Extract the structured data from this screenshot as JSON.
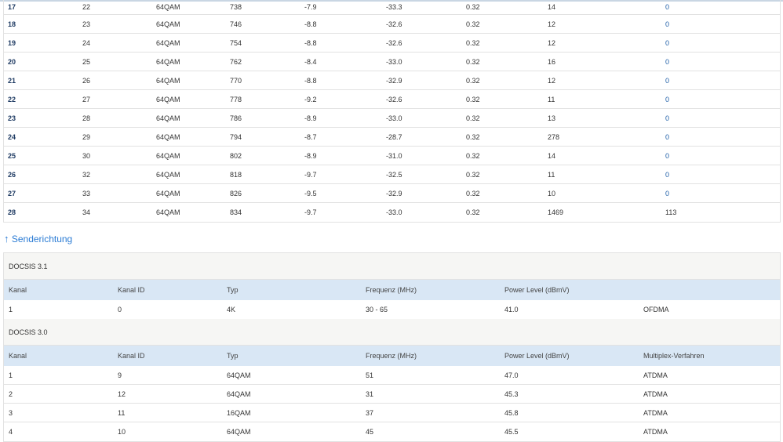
{
  "downstream": {
    "rows": [
      [
        "17",
        "22",
        "64QAM",
        "738",
        "-7.9",
        "-33.3",
        "0.32",
        "14",
        "0"
      ],
      [
        "18",
        "23",
        "64QAM",
        "746",
        "-8.8",
        "-32.6",
        "0.32",
        "12",
        "0"
      ],
      [
        "19",
        "24",
        "64QAM",
        "754",
        "-8.8",
        "-32.6",
        "0.32",
        "12",
        "0"
      ],
      [
        "20",
        "25",
        "64QAM",
        "762",
        "-8.4",
        "-33.0",
        "0.32",
        "16",
        "0"
      ],
      [
        "21",
        "26",
        "64QAM",
        "770",
        "-8.8",
        "-32.9",
        "0.32",
        "12",
        "0"
      ],
      [
        "22",
        "27",
        "64QAM",
        "778",
        "-9.2",
        "-32.6",
        "0.32",
        "11",
        "0"
      ],
      [
        "23",
        "28",
        "64QAM",
        "786",
        "-8.9",
        "-33.0",
        "0.32",
        "13",
        "0"
      ],
      [
        "24",
        "29",
        "64QAM",
        "794",
        "-8.7",
        "-28.7",
        "0.32",
        "278",
        "0"
      ],
      [
        "25",
        "30",
        "64QAM",
        "802",
        "-8.9",
        "-31.0",
        "0.32",
        "14",
        "0"
      ],
      [
        "26",
        "32",
        "64QAM",
        "818",
        "-9.7",
        "-32.5",
        "0.32",
        "11",
        "0"
      ],
      [
        "27",
        "33",
        "64QAM",
        "826",
        "-9.5",
        "-32.9",
        "0.32",
        "10",
        "0"
      ],
      [
        "28",
        "34",
        "64QAM",
        "834",
        "-9.7",
        "-33.0",
        "0.32",
        "1469",
        "113"
      ]
    ]
  },
  "upstream": {
    "arrow": "↑",
    "title": "Senderichtung",
    "docsis31": {
      "label": "DOCSIS 3.1",
      "headers": [
        "Kanal",
        "Kanal ID",
        "Typ",
        "Frequenz (MHz)",
        "Power Level (dBmV)",
        ""
      ],
      "rows": [
        [
          "1",
          "0",
          "4K",
          "30 - 65",
          "41.0",
          "OFDMA"
        ]
      ]
    },
    "docsis30": {
      "label": "DOCSIS 3.0",
      "headers": [
        "Kanal",
        "Kanal ID",
        "Typ",
        "Frequenz (MHz)",
        "Power Level (dBmV)",
        "Multiplex-Verfahren"
      ],
      "rows": [
        [
          "1",
          "9",
          "64QAM",
          "51",
          "47.0",
          "ATDMA"
        ],
        [
          "2",
          "12",
          "64QAM",
          "31",
          "45.3",
          "ATDMA"
        ],
        [
          "3",
          "11",
          "16QAM",
          "37",
          "45.8",
          "ATDMA"
        ],
        [
          "4",
          "10",
          "64QAM",
          "45",
          "45.5",
          "ATDMA"
        ]
      ]
    }
  },
  "colors": {
    "header_bg": "#d9e7f5",
    "group_bg": "#f6f6f4",
    "link": "#2a7bd4",
    "channel_number": "#1f3b63"
  }
}
